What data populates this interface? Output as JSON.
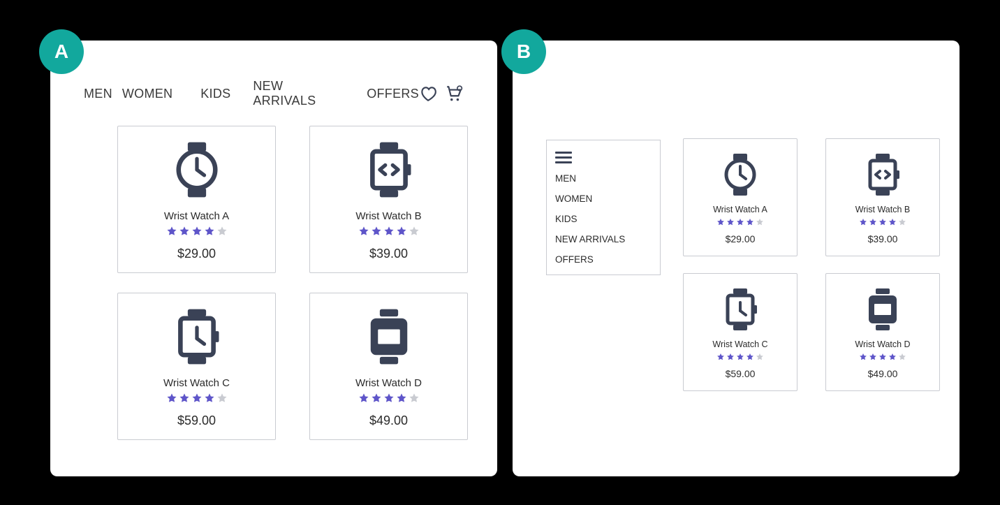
{
  "badges": {
    "a": "A",
    "b": "B"
  },
  "nav": [
    "MEN",
    "WOMEN",
    "KIDS",
    "NEW ARRIVALS",
    "OFFERS"
  ],
  "star": {
    "full_color": "#5e55c9",
    "empty_color": "#c9cbd1"
  },
  "products": [
    {
      "name": "Wrist Watch A",
      "price": "$29.00",
      "rating": 4
    },
    {
      "name": "Wrist Watch B",
      "price": "$39.00",
      "rating": 4
    },
    {
      "name": "Wrist Watch C",
      "price": "$59.00",
      "rating": 4
    },
    {
      "name": "Wrist Watch D",
      "price": "$49.00",
      "rating": 4
    }
  ]
}
